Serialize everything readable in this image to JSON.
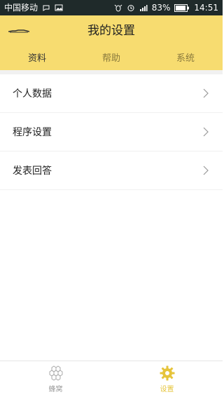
{
  "status_bar": {
    "carrier": "中国移动",
    "battery_percent": "83%",
    "time": "14:51"
  },
  "header": {
    "title": "我的设置"
  },
  "tabs": [
    {
      "label": "资料",
      "active": true
    },
    {
      "label": "帮助",
      "active": false
    },
    {
      "label": "系统",
      "active": false
    }
  ],
  "settings": {
    "items": [
      {
        "label": "个人数据"
      },
      {
        "label": "程序设置"
      },
      {
        "label": "发表回答"
      }
    ]
  },
  "bottom_nav": {
    "items": [
      {
        "label": "蜂窝",
        "icon": "hexagon-cluster-icon",
        "active": false
      },
      {
        "label": "设置",
        "icon": "gear-icon",
        "active": true
      }
    ]
  },
  "colors": {
    "header_bg": "#f7dc70",
    "active_accent": "#e6c43b",
    "status_bar_bg": "#1f2a2a"
  }
}
